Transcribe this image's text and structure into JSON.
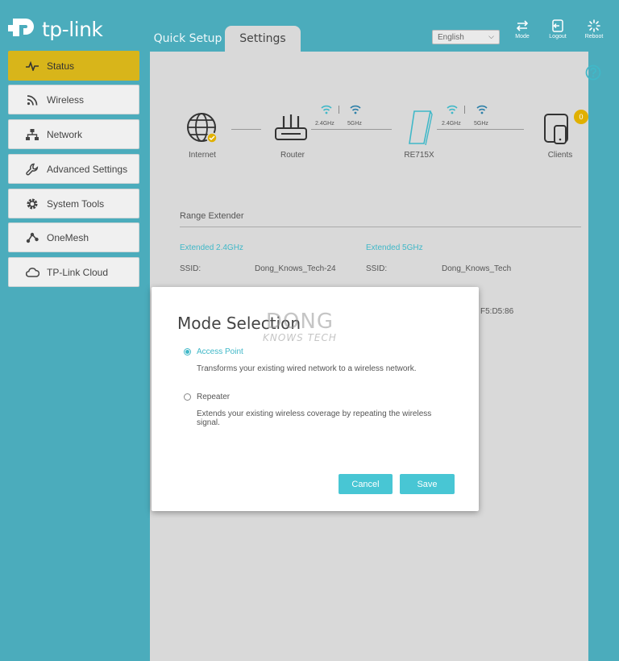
{
  "header": {
    "logo_text": "tp-link",
    "tabs": [
      {
        "label": "Quick Setup"
      },
      {
        "label": "Settings"
      }
    ],
    "language": "English",
    "actions": [
      {
        "label": "Mode"
      },
      {
        "label": "Logout"
      },
      {
        "label": "Reboot"
      }
    ]
  },
  "sidebar": {
    "items": [
      {
        "label": "Status",
        "icon": "pulse-icon",
        "active": true
      },
      {
        "label": "Wireless",
        "icon": "wifi-icon"
      },
      {
        "label": "Network",
        "icon": "network-icon"
      },
      {
        "label": "Advanced Settings",
        "icon": "wrench-icon"
      },
      {
        "label": "System Tools",
        "icon": "gear-icon"
      },
      {
        "label": "OneMesh",
        "icon": "onemesh-icon"
      },
      {
        "label": "TP-Link Cloud",
        "icon": "cloud-icon"
      }
    ]
  },
  "topology": {
    "nodes": [
      {
        "label": "Internet",
        "icon": "globe-icon"
      },
      {
        "label": "Router",
        "icon": "router-icon"
      },
      {
        "label": "RE715X",
        "icon": "extender-icon"
      },
      {
        "label": "Clients",
        "icon": "clients-icon",
        "badge": "0"
      }
    ],
    "bands": [
      "2.4GHz",
      "5GHz"
    ]
  },
  "range_extender": {
    "title": "Range Extender",
    "extended_24": {
      "title": "Extended 2.4GHz",
      "ssid_label": "SSID:",
      "ssid_value": "Dong_Knows_Tech-24"
    },
    "extended_5": {
      "title": "Extended 5GHz",
      "ssid_label": "SSID:",
      "ssid_value": "Dong_Knows_Tech"
    },
    "mac_partial": "F5:D5:86"
  },
  "modal": {
    "title": "Mode Selection",
    "watermark_line1": "DONG",
    "watermark_line2": "KNOWS TECH",
    "options": [
      {
        "label": "Access Point",
        "description": "Transforms your existing wired network to a wireless network.",
        "selected": true
      },
      {
        "label": "Repeater",
        "description": "Extends your existing wireless coverage by repeating the wireless signal.",
        "selected": false
      }
    ],
    "cancel_label": "Cancel",
    "save_label": "Save"
  },
  "colors": {
    "brand_teal": "#4bacbc",
    "active_yellow": "#d8b51a",
    "accent_cyan": "#40b8c8",
    "button_cyan": "#48c6d4",
    "panel_gray": "#d9d9d9"
  }
}
